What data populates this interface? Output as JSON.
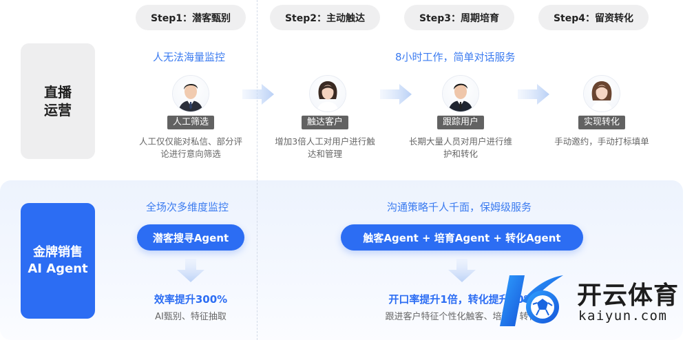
{
  "steps": [
    {
      "label": "Step1：潜客甄别"
    },
    {
      "label": "Step2：主动触达"
    },
    {
      "label": "Step3：周期培育"
    },
    {
      "label": "Step4：留资转化"
    }
  ],
  "rows": {
    "live": {
      "line1": "直播",
      "line2": "运营"
    },
    "agent": {
      "line1": "金牌销售",
      "line2": "AI Agent"
    }
  },
  "live_row": {
    "headline_left": "人无法海量监控",
    "headline_right": "8小时工作，简单对话服务",
    "cards": [
      {
        "role": "人工筛选",
        "desc": "人工仅仅能对私信、部分评论进行意向筛选",
        "avatar": "man-avatar-icon"
      },
      {
        "role": "触达客户",
        "desc": "增加3倍人工对用户进行触达和管理",
        "avatar": "woman-avatar-icon"
      },
      {
        "role": "跟踪用户",
        "desc": "长期大量人员对用户进行维护和转化",
        "avatar": "man-avatar-icon"
      },
      {
        "role": "实现转化",
        "desc": "手动邀约，手动打标填单",
        "avatar": "woman-avatar-icon"
      }
    ]
  },
  "agent_row": {
    "headline_left": "全场次多维度监控",
    "headline_right": "沟通策略千人千面，保姆级服务",
    "pill_left": "潜客搜寻Agent",
    "pill_right": "触客Agent + 培育Agent + 转化Agent",
    "effect_left": {
      "title": "效率提升300%",
      "sub": "AI甄别、特征抽取"
    },
    "effect_right": {
      "title": "开口率提升1倍，转化提升50%",
      "sub": "跟进客户特征个性化触客、培育、转化"
    }
  },
  "watermark": {
    "cn": "开云体育",
    "en": "kaiyun.com"
  },
  "colors": {
    "accent": "#2c6df3",
    "headline": "#3b7bf0",
    "tag": "#626262",
    "pill_gray": "#efeff0"
  }
}
